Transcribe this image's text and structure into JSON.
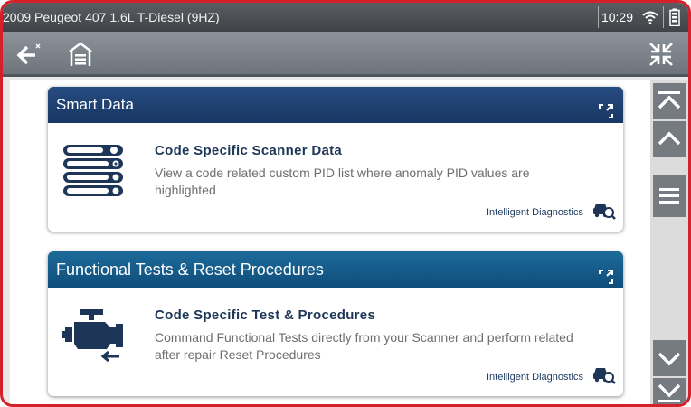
{
  "status_bar": {
    "title": "2009 Peugeot 407 1.6L T-Diesel (9HZ)",
    "time": "10:29"
  },
  "toolbar": {
    "back_icon": "back-arrow-icon",
    "home_icon": "garage-home-icon",
    "collapse_icon": "collapse-arrows-icon"
  },
  "cards": [
    {
      "header": "Smart Data",
      "title": "Code Specific Scanner Data",
      "description": "View a code related custom PID list where anomaly PID values are highlighted",
      "footer": "Intelligent Diagnostics",
      "icon": "pid-list-icon"
    },
    {
      "header": "Functional Tests & Reset Procedures",
      "title": "Code Specific Test & Procedures",
      "description": "Command Functional Tests directly from your Scanner and perform related after repair Reset Procedures",
      "footer": "Intelligent Diagnostics",
      "icon": "engine-icon"
    }
  ],
  "scrollbar": {
    "buttons": [
      "scroll-top",
      "scroll-up",
      "scroll-handle",
      "scroll-down",
      "scroll-bottom"
    ]
  },
  "colors": {
    "frame": "#d4202a",
    "card_header_1": "#1f4275",
    "card_header_2": "#165d8d",
    "accent_text": "#1d3557"
  }
}
